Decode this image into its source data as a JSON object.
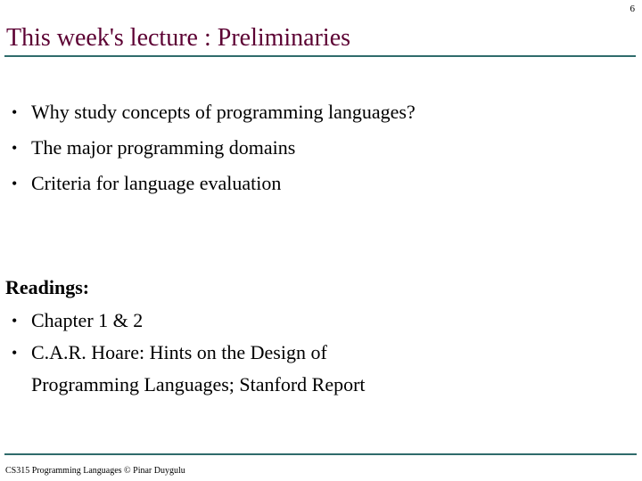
{
  "slide": {
    "number": "6",
    "title": "This week's lecture : Preliminaries",
    "accent_color": "#2F6B6B",
    "title_color": "#5C0033",
    "background_color": "#FFFFFF",
    "text_color": "#000000"
  },
  "bullets": [
    {
      "marker": "•",
      "text": "Why study concepts of programming languages?"
    },
    {
      "marker": "•",
      "text": "The major programming domains"
    },
    {
      "marker": "•",
      "text": "Criteria for language evaluation"
    }
  ],
  "readings": {
    "heading": "Readings:",
    "items": [
      {
        "marker": "•",
        "line1": "Chapter 1 & 2",
        "line2": ""
      },
      {
        "marker": "•",
        "line1": "C.A.R. Hoare: Hints on the Design of",
        "line2": "Programming Languages; Stanford Report"
      }
    ]
  },
  "footer": {
    "text": "CS315 Programming Languages © Pinar Duygulu"
  }
}
